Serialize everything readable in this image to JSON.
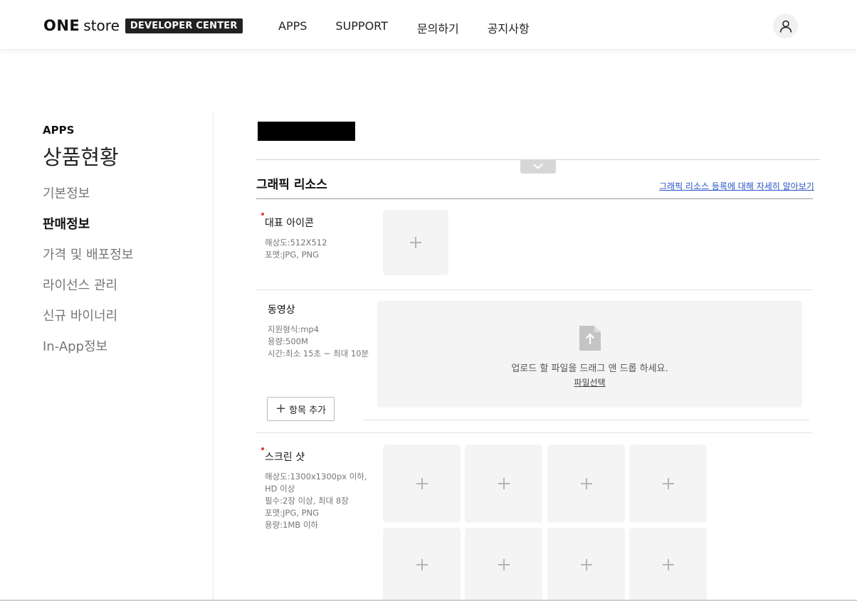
{
  "header": {
    "logo_one": "ONE",
    "logo_store": "store",
    "logo_badge": "DEVELOPER CENTER",
    "nav": [
      "APPS",
      "SUPPORT",
      "문의하기",
      "공지사항"
    ]
  },
  "sidebar": {
    "section": "APPS",
    "title": "상품현황",
    "items": [
      {
        "label": "기본정보"
      },
      {
        "label": "판매정보"
      },
      {
        "label": "가격 및 배포정보"
      },
      {
        "label": "라이선스 관리"
      },
      {
        "label": "신규 바이너리"
      },
      {
        "label": "In-App정보"
      }
    ]
  },
  "main": {
    "section_title": "그래픽 리소스",
    "help_link": "그래픽 리소스 등록에 대해 자세히 알아보기",
    "icon": {
      "label": "대표 아이콘",
      "resolution": "해상도:512X512",
      "format": "포맷:JPG, PNG"
    },
    "video": {
      "label": "동영상",
      "format": "지원형식:mp4",
      "size": "용량:500M",
      "duration": "시간:최소 15초 ~ 최대 10분",
      "dropzone_text": "업로드 할 파일을 드래그 앤 드롭 하세요.",
      "select_file": "파일선택",
      "add_button": "항목 추가"
    },
    "screenshot": {
      "label": "스크린 샷",
      "resolution_1": "해상도:1300x1300px 이하,",
      "resolution_2": "HD 이상",
      "count": "필수:2장 이상, 최대 8장",
      "format": "포맷:JPG, PNG",
      "size": "용량:1MB 이하"
    }
  },
  "colors": {
    "accent_link": "#2a55c7",
    "required_dot": "#e43a3a"
  }
}
